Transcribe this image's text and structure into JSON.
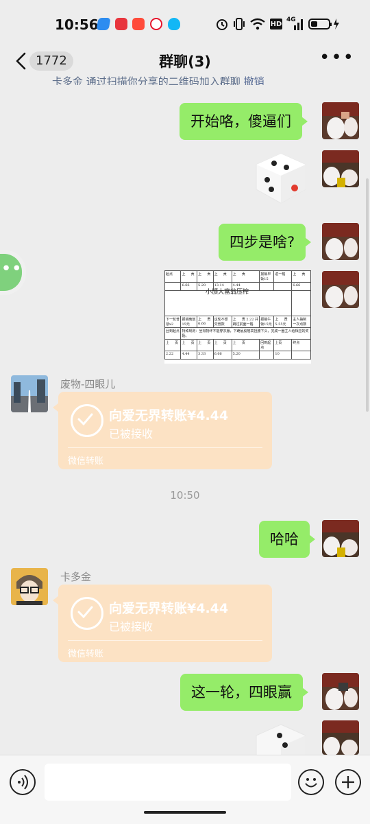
{
  "status_bar": {
    "time": "10:56",
    "network": "4G",
    "hd": "HD"
  },
  "nav": {
    "badge_count": "1772",
    "title": "群聊(3)"
  },
  "system_notice": {
    "prefix": "卡多金",
    "text": " 通过扫描你分享的二维码加入群聊 ",
    "link": "撤销"
  },
  "messages": {
    "m1": "开始咯，傻逼们",
    "m3": "四步是啥?",
    "m5_name": "废物-四眼儿",
    "m5_title": "向爱无界转账¥4.44",
    "m5_status": "已被接收",
    "m5_footer": "微信转账",
    "timestamp": "10:50",
    "m6": "哈哈",
    "m7_name": "卡多金",
    "m7_title": "向爱无界转账¥4.44",
    "m7_status": "已被接收",
    "m7_footer": "微信转账",
    "m8": "这一轮，四眼赢"
  },
  "table_image": {
    "caption": "小颁大富翁压榨",
    "row1": [
      "起点",
      "上 　 贡",
      "上 　 贡",
      "上 　 贡",
      "上 　 贡",
      "报销早饭15",
      "返一格",
      "上 　 贡"
    ],
    "row2": [
      "",
      "6.66",
      "5.20",
      "13.14",
      "4.44",
      "",
      "",
      "6.66"
    ],
    "row3": [
      "下一轮普惩x2",
      "报销晚饭15元",
      "上 　 贡 6.66",
      "这轮不想交普款",
      "上 　 贡 2.22 并跳过前面一格",
      "报销午饭15元",
      "上 　 贡 5.55元",
      "主人抽制一次点数"
    ],
    "row4": [
      "回到起点",
      "特殊规则：坐得物坏不能穿衣服，下跪屁股翘高扭腰下头，完成一圈主人给相应的奖励。"
    ],
    "row5": [
      "上 　 贡",
      "上 　 贡",
      "上 　 贡",
      "上 　 贡",
      "上 　 贡",
      "回到起点",
      "上贡",
      "终点"
    ],
    "row6": [
      "2.22",
      "4.44",
      "3.33",
      "6.66",
      "5.20",
      "",
      "10",
      ""
    ]
  }
}
